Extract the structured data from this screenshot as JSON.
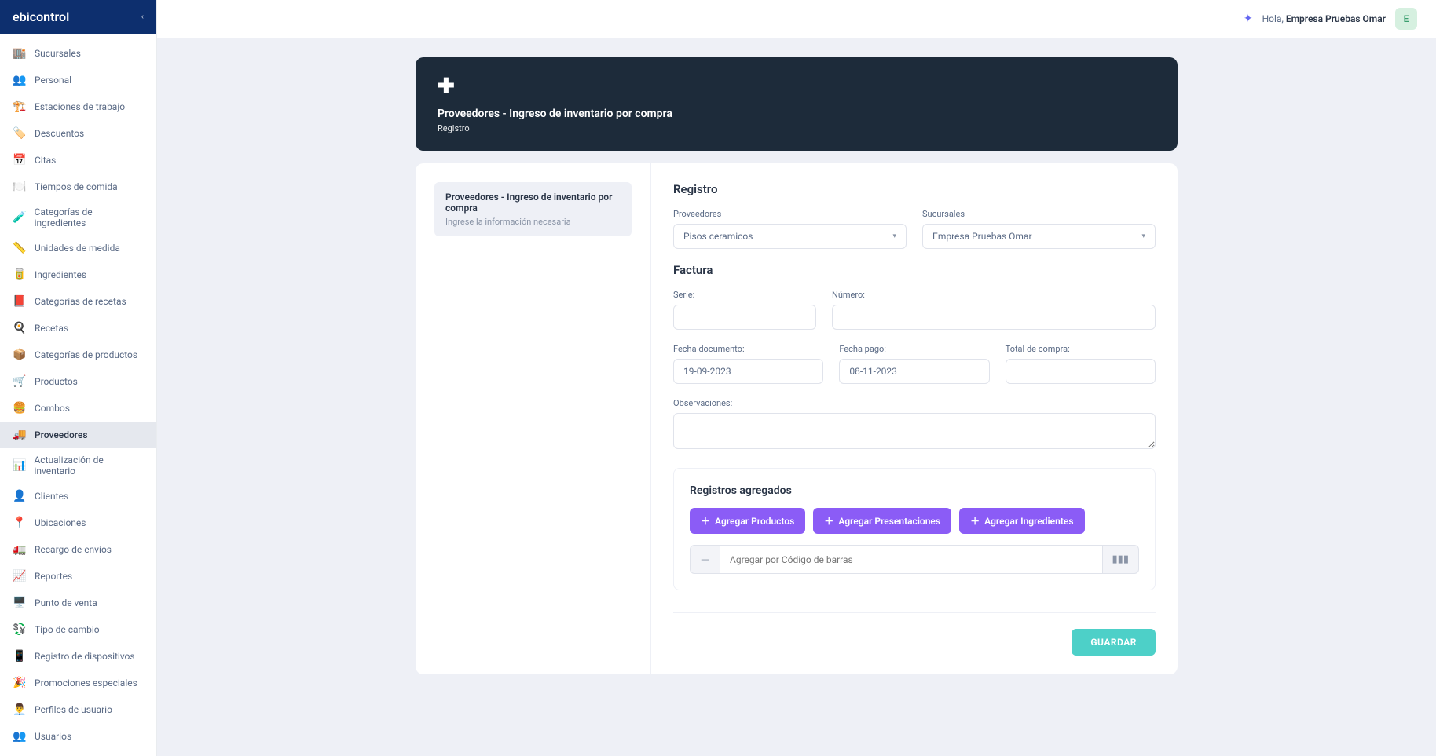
{
  "brand": "ebicontrol",
  "topbar": {
    "greeting_prefix": "Hola, ",
    "user_name": "Empresa Pruebas Omar",
    "avatar_initial": "E"
  },
  "sidebar": {
    "items": [
      {
        "icon": "🏬",
        "label": "Sucursales"
      },
      {
        "icon": "👥",
        "label": "Personal"
      },
      {
        "icon": "🏗️",
        "label": "Estaciones de trabajo"
      },
      {
        "icon": "🏷️",
        "label": "Descuentos"
      },
      {
        "icon": "📅",
        "label": "Citas"
      },
      {
        "icon": "🍽️",
        "label": "Tiempos de comida"
      },
      {
        "icon": "🧪",
        "label": "Categorías de ingredientes"
      },
      {
        "icon": "📏",
        "label": "Unidades de medida"
      },
      {
        "icon": "🥫",
        "label": "Ingredientes"
      },
      {
        "icon": "📕",
        "label": "Categorías de recetas"
      },
      {
        "icon": "🍳",
        "label": "Recetas"
      },
      {
        "icon": "📦",
        "label": "Categorías de productos"
      },
      {
        "icon": "🛒",
        "label": "Productos"
      },
      {
        "icon": "🍔",
        "label": "Combos"
      },
      {
        "icon": "🚚",
        "label": "Proveedores",
        "active": true
      },
      {
        "icon": "📊",
        "label": "Actualización de inventario"
      },
      {
        "icon": "👤",
        "label": "Clientes"
      },
      {
        "icon": "📍",
        "label": "Ubicaciones"
      },
      {
        "icon": "🚛",
        "label": "Recargo de envíos"
      },
      {
        "icon": "📈",
        "label": "Reportes"
      },
      {
        "icon": "🖥️",
        "label": "Punto de venta"
      },
      {
        "icon": "💱",
        "label": "Tipo de cambio"
      },
      {
        "icon": "📱",
        "label": "Registro de dispositivos"
      },
      {
        "icon": "🎉",
        "label": "Promociones especiales"
      },
      {
        "icon": "👨‍💼",
        "label": "Perfiles de usuario"
      },
      {
        "icon": "👥",
        "label": "Usuarios"
      }
    ]
  },
  "page_header": {
    "title": "Proveedores - Ingreso de inventario por compra",
    "subtitle": "Registro"
  },
  "step": {
    "title": "Proveedores - Ingreso de inventario por compra",
    "desc": "Ingrese la información necesaria"
  },
  "form": {
    "section_title": "Registro",
    "proveedores_label": "Proveedores",
    "proveedores_value": "Pisos ceramicos",
    "sucursales_label": "Sucursales",
    "sucursales_value": "Empresa Pruebas Omar",
    "factura_title": "Factura",
    "serie_label": "Serie:",
    "serie_value": "",
    "numero_label": "Número:",
    "numero_value": "",
    "fecha_doc_label": "Fecha documento:",
    "fecha_doc_value": "19-09-2023",
    "fecha_pago_label": "Fecha pago:",
    "fecha_pago_value": "08-11-2023",
    "total_label": "Total de compra:",
    "total_value": "",
    "observaciones_label": "Observaciones:",
    "observaciones_value": ""
  },
  "registros": {
    "title": "Registros agregados",
    "btn_productos": "Agregar Productos",
    "btn_presentaciones": "Agregar Presentaciones",
    "btn_ingredientes": "Agregar Ingredientes",
    "barcode_placeholder": "Agregar por Código de barras"
  },
  "actions": {
    "save": "GUARDAR"
  }
}
